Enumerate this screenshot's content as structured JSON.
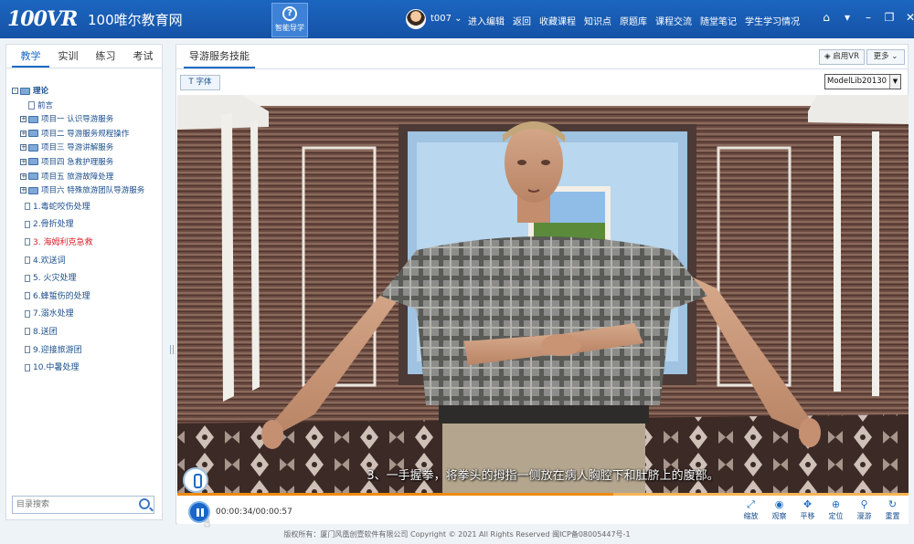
{
  "header": {
    "logo": "100VR",
    "brand": "100唯尔教育网",
    "guide_label": "智能导学",
    "user": "t007 ⌄",
    "nav": [
      "进入编辑",
      "返回",
      "收藏课程",
      "知识点",
      "原题库",
      "课程交流",
      "随堂笔记",
      "学生学习情况"
    ]
  },
  "left": {
    "tabs": [
      "教学",
      "实训",
      "练习",
      "考试"
    ],
    "tree": {
      "root": "理论",
      "preface": "前言",
      "projects": [
        "项目一 认识导游服务",
        "项目二 导游服务规程操作",
        "项目三 导游讲解服务",
        "项目四 急救护理服务",
        "项目五 旅游故障处理",
        "项目六 特殊旅游团队导游服务"
      ],
      "items": [
        "1.毒蛇咬伤处理",
        "2.骨折处理",
        "3. 海姆利克急救",
        "4.欢送词",
        "5. 火灾处理",
        "6.蜂蜇伤的处理",
        "7.溺水处理",
        "8.送团",
        "9.迎接旅游团",
        "10.中暑处理"
      ]
    },
    "search_placeholder": "目录搜索"
  },
  "right": {
    "tab": "导游服务技能",
    "vr_button": "启用VR",
    "more_button": "更多 ⌄",
    "font_button": "字体",
    "model_select": "ModelLib20130"
  },
  "player": {
    "subtitle": "3、一手握拳，将拳头的拇指一侧放在病人胸腔下和肚脐上的腹部。",
    "time": "00:00:34/00:00:57",
    "progress": 0.596,
    "tools": [
      {
        "icon": "⤢",
        "label": "缩放"
      },
      {
        "icon": "◉",
        "label": "观察"
      },
      {
        "icon": "✥",
        "label": "平移"
      },
      {
        "icon": "⊕",
        "label": "定位"
      },
      {
        "icon": "⚲",
        "label": "漫游"
      },
      {
        "icon": "↻",
        "label": "重置"
      }
    ]
  },
  "footer": "版权所有：厦门风凰创壹软件有限公司   Copyright © 2021   All Rights Reserved   闽ICP备08005447号-1",
  "colors": {
    "header": "#1c66c0",
    "accent": "#1d6bc4",
    "progress": "#ee8a10",
    "active_item": "#d9202a"
  }
}
